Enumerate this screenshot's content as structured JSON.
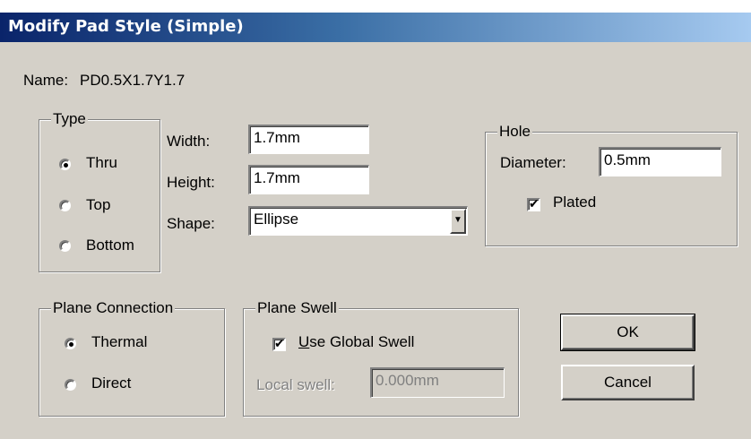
{
  "window": {
    "title": "Modify Pad Style (Simple)"
  },
  "name_row": {
    "label": "Name:",
    "value": "PD0.5X1.7Y1.7"
  },
  "type_group": {
    "legend": "Type",
    "options": [
      {
        "label": "Thru",
        "selected": true
      },
      {
        "label": "Top",
        "selected": false
      },
      {
        "label": "Bottom",
        "selected": false
      }
    ]
  },
  "dimensions": {
    "width_label": "Width:",
    "width_value": "1.7mm",
    "height_label": "Height:",
    "height_value": "1.7mm",
    "shape_label": "Shape:",
    "shape_value": "Ellipse"
  },
  "hole_group": {
    "legend": "Hole",
    "diameter_label": "Diameter:",
    "diameter_value": "0.5mm",
    "plated_label": "Plated",
    "plated_checked": true
  },
  "plane_connection": {
    "legend": "Plane Connection",
    "options": [
      {
        "label": "Thermal",
        "selected": true
      },
      {
        "label": "Direct",
        "selected": false
      }
    ]
  },
  "plane_swell": {
    "legend": "Plane Swell",
    "use_global_accel": "U",
    "use_global_rest": "se Global Swell",
    "use_global_checked": true,
    "local_label": "Local swell:",
    "local_value": "0.000mm"
  },
  "buttons": {
    "ok": "OK",
    "cancel": "Cancel"
  }
}
